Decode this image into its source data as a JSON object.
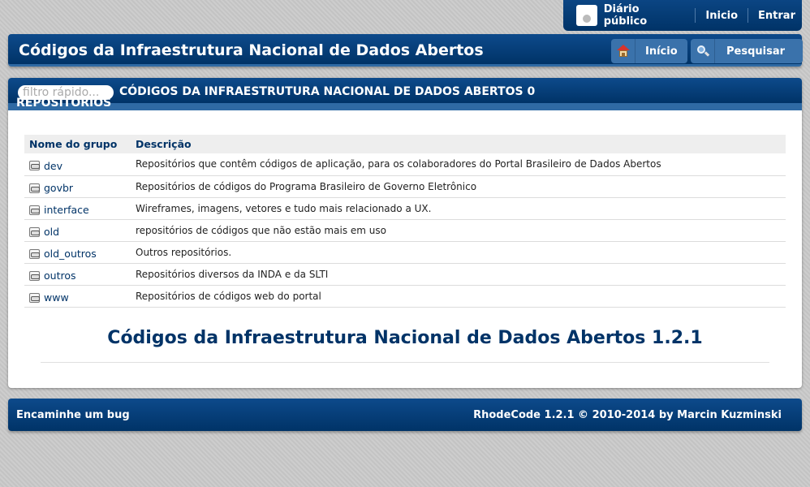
{
  "userbar": {
    "user": "Diário público",
    "inicio": "Inicio",
    "entrar": "Entrar"
  },
  "header": {
    "title": "Códigos da Infraestrutura Nacional de Dados Abertos",
    "home_button": "Início",
    "search_button": "Pesquisar"
  },
  "main": {
    "filter_placeholder": "filtro rápido...",
    "breadcrumb": "Códigos da Infraestrutura Nacional de Dados Abertos 0 repositórios",
    "columns": [
      "Nome do grupo",
      "Descrição"
    ],
    "rows": [
      {
        "name": "dev",
        "description": "Repositórios que contêm códigos de aplicação, para os colaboradores do Portal Brasileiro de Dados Abertos"
      },
      {
        "name": "govbr",
        "description": "Repositórios de códigos do Programa Brasileiro de Governo Eletrônico"
      },
      {
        "name": "interface",
        "description": "Wireframes, imagens, vetores e tudo mais relacionado a UX."
      },
      {
        "name": "old",
        "description": "repositórios de códigos que não estão mais em uso"
      },
      {
        "name": "old_outros",
        "description": "Outros repositórios."
      },
      {
        "name": "outros",
        "description": "Repositórios diversos da INDA e da SLTI"
      },
      {
        "name": "www",
        "description": "Repositórios de códigos web do portal"
      }
    ],
    "version_title": "Códigos da Infraestrutura Nacional de Dados Abertos 1.2.1"
  },
  "footer": {
    "bug_link": "Encaminhe um bug",
    "copyright": "RhodeCode 1.2.1 © 2010-2014 by Marcin Kuzminski"
  },
  "colors": {
    "brand_dark": "#003367",
    "brand_light": "#2f6aa4",
    "button": "#3a72ab"
  },
  "icons": [
    "user-avatar-icon",
    "home-icon",
    "search-icon",
    "group-icon"
  ]
}
